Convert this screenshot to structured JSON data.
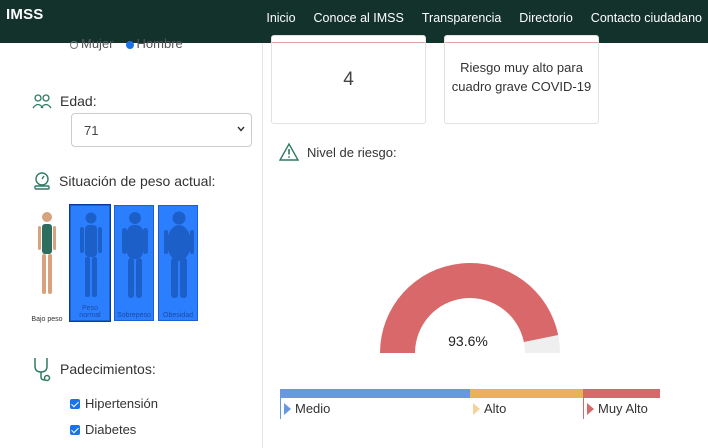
{
  "navbar": {
    "brand": "IMSS",
    "links": [
      "Inicio",
      "Conoce al IMSS",
      "Transparencia",
      "Directorio",
      "Contacto ciudadano"
    ]
  },
  "form": {
    "sex": {
      "options": [
        "Mujer",
        "Hombre"
      ],
      "selected": "Hombre"
    },
    "age": {
      "label": "Edad:",
      "value": "71"
    },
    "weight": {
      "label": "Situación de peso actual:",
      "options": [
        "Bajo peso",
        "Peso normal",
        "Sobrepeso",
        "Obesidad"
      ],
      "selected": "Peso normal"
    },
    "conditions": {
      "label": "Padecimientos:",
      "items": [
        {
          "label": "Hipertensión",
          "checked": true
        },
        {
          "label": "Diabetes",
          "checked": true
        }
      ]
    }
  },
  "results": {
    "count_card": {
      "value": "4"
    },
    "risk_card": {
      "line1": "Riesgo muy alto para",
      "line2": "cuadro grave COVID-19"
    },
    "risk_level": {
      "title": "Nivel de riesgo:",
      "percent_label": "93.6%",
      "percent": 93.6,
      "gauge_color": "#d9686a",
      "gauge_track_color": "#efefef"
    },
    "scale": [
      {
        "label": "Medio",
        "color": "#6a98e0"
      },
      {
        "label": "Alto",
        "color": "#e8b15a"
      },
      {
        "label": "Muy Alto",
        "color": "#d9686a"
      }
    ]
  }
}
